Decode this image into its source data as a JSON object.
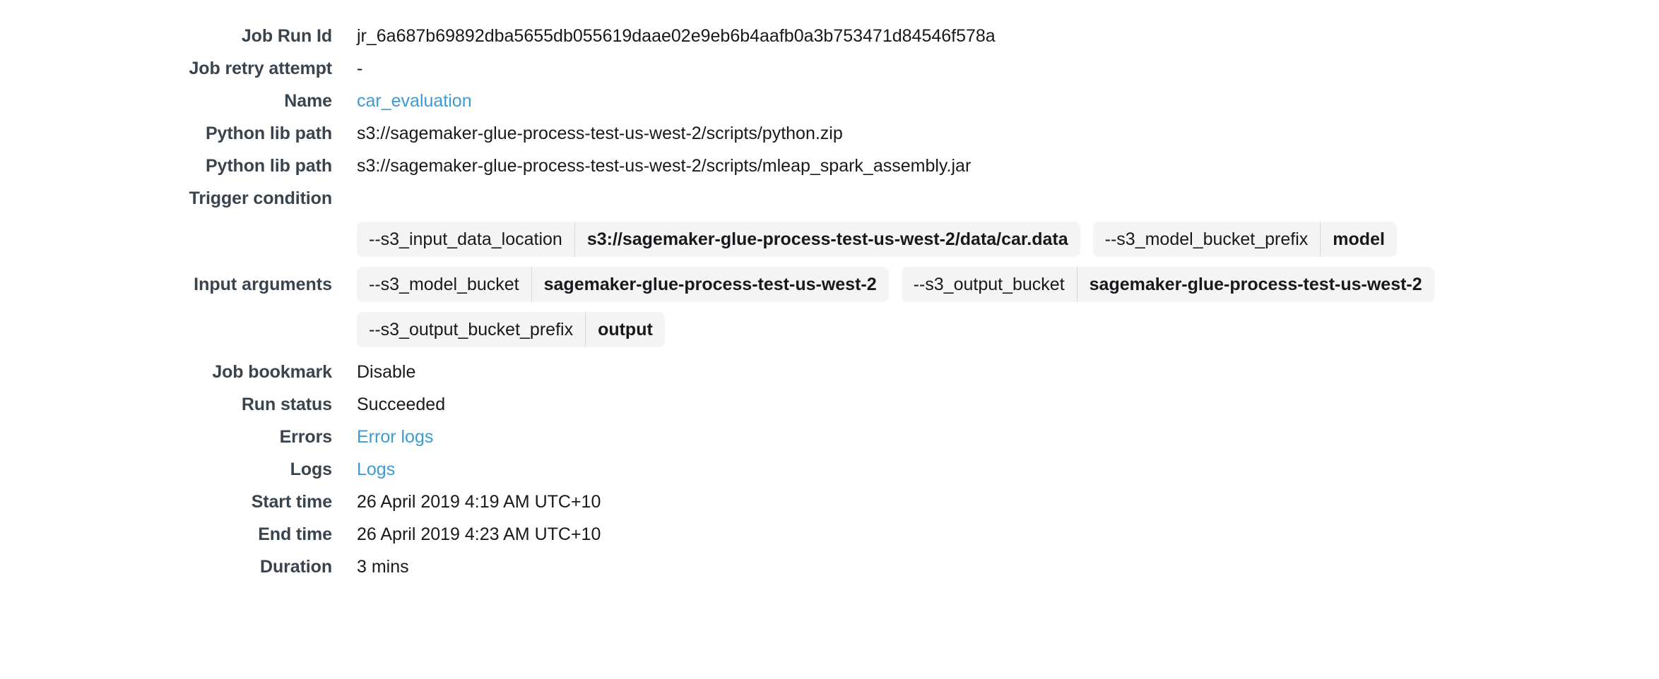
{
  "detail": {
    "rows": [
      {
        "label": "Job Run Id",
        "value": "jr_6a687b69892dba5655db055619daae02e9eb6b4aafb0a3b753471d84546f578a",
        "type": "text"
      },
      {
        "label": "Job retry attempt",
        "value": "-",
        "type": "text"
      },
      {
        "label": "Name",
        "value": "car_evaluation",
        "type": "link"
      },
      {
        "label": "Python lib path",
        "value": "s3://sagemaker-glue-process-test-us-west-2/scripts/python.zip",
        "type": "text"
      },
      {
        "label": "Python lib path",
        "value": "s3://sagemaker-glue-process-test-us-west-2/scripts/mleap_spark_assembly.jar",
        "type": "text"
      },
      {
        "label": "Trigger condition",
        "value": "",
        "type": "empty"
      }
    ],
    "input_arguments": {
      "label": "Input arguments",
      "lines": [
        [
          {
            "key": "--s3_input_data_location",
            "value": "s3://sagemaker-glue-process-test-us-west-2/data/car.data"
          },
          {
            "key": "--s3_model_bucket_prefix",
            "value": "model"
          }
        ],
        [
          {
            "key": "--s3_model_bucket",
            "value": "sagemaker-glue-process-test-us-west-2"
          },
          {
            "key": "--s3_output_bucket",
            "value": "sagemaker-glue-process-test-us-west-2"
          }
        ],
        [
          {
            "key": "--s3_output_bucket_prefix",
            "value": "output"
          }
        ]
      ]
    },
    "rows_bottom": [
      {
        "label": "Job bookmark",
        "value": "Disable",
        "type": "text"
      },
      {
        "label": "Run status",
        "value": "Succeeded",
        "type": "text"
      },
      {
        "label": "Errors",
        "value": "Error logs",
        "type": "link"
      },
      {
        "label": "Logs",
        "value": "Logs",
        "type": "link"
      },
      {
        "label": "Start time",
        "value": "26 April 2019 4:19 AM UTC+10",
        "type": "text"
      },
      {
        "label": "End time",
        "value": "26 April 2019 4:23 AM UTC+10",
        "type": "text"
      },
      {
        "label": "Duration",
        "value": "3 mins",
        "type": "text"
      }
    ]
  },
  "colors": {
    "label": "#39444f",
    "value": "#17191c",
    "link": "#3d9ad5",
    "chip_bg": "#f4f4f4",
    "chip_divider": "#d9d9d9",
    "page_bg": "#ffffff"
  }
}
